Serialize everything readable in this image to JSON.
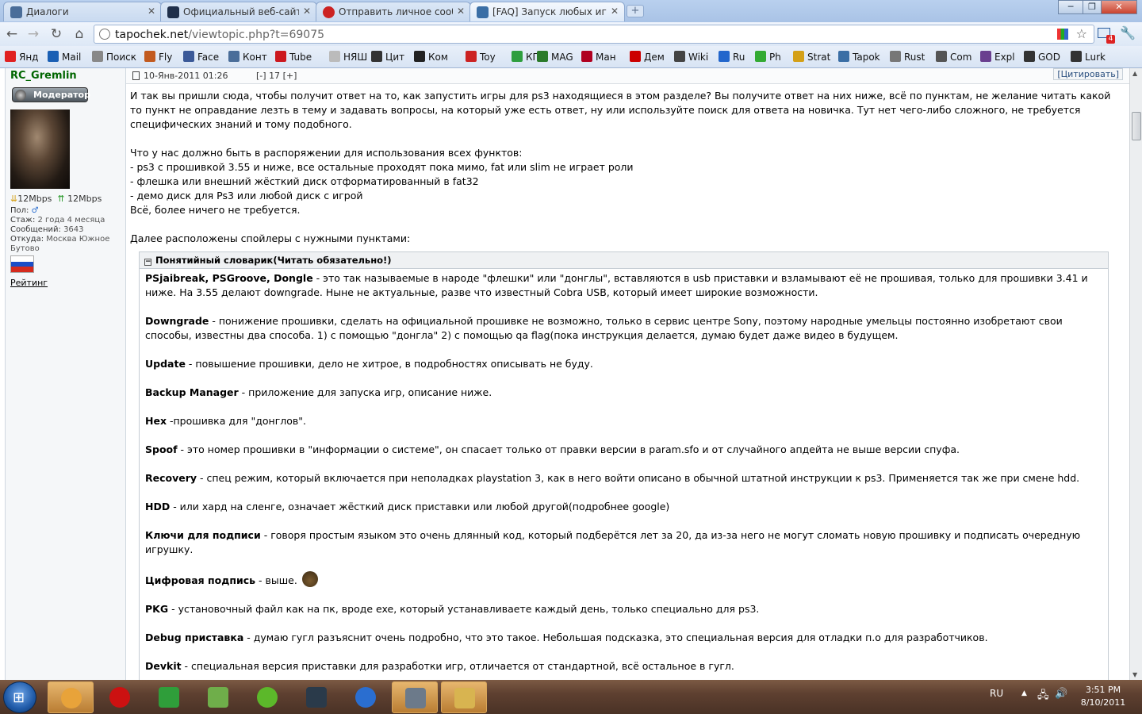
{
  "browser": {
    "tabs": [
      {
        "label": "Диалоги",
        "icon": "vk-icon",
        "color": "#4a6d99"
      },
      {
        "label": "Официальный веб-сайт Pl",
        "icon": "playstation-icon",
        "color": "#1f2f4a"
      },
      {
        "label": "Отправить личное сообщ",
        "icon": "tapochek-icon",
        "color": "#cc2222"
      },
      {
        "label": "[FAQ] Запуск любых игр и",
        "icon": "settings-icon",
        "color": "#3a6ea5"
      }
    ],
    "close_glyph": "✕",
    "new_tab_glyph": "+",
    "window": {
      "minimize": "─",
      "maximize": "❐",
      "close": "✕"
    },
    "url_host": "tapochek.net",
    "url_path": "/viewtopic.php?t=69075",
    "mail_badge": "4",
    "bookmarks": [
      {
        "label": "Янд",
        "color": "#e02020"
      },
      {
        "label": "Mail",
        "color": "#1a5fb4"
      },
      {
        "label": "Поиск",
        "color": "#888888"
      },
      {
        "label": "Fly",
        "color": "#c25a1f"
      },
      {
        "label": "Face",
        "color": "#3b5998"
      },
      {
        "label": "Конт",
        "color": "#4a6d99"
      },
      {
        "label": "Tube",
        "color": "#cc181e"
      },
      {
        "label": "НЯШ",
        "color": "#bbbbbb"
      },
      {
        "label": "Цит",
        "color": "#333333"
      },
      {
        "label": "Ком",
        "color": "#222222"
      },
      {
        "label": "Toy",
        "color": "#cc2222"
      },
      {
        "label": "КГ",
        "color": "#2e9e3e"
      },
      {
        "label": "MAG",
        "color": "#2a7a2a"
      },
      {
        "label": "Ман",
        "color": "#b00020"
      },
      {
        "label": "Дем",
        "color": "#cc0000"
      },
      {
        "label": "Wiki",
        "color": "#444444"
      },
      {
        "label": "Ru",
        "color": "#2266cc"
      },
      {
        "label": "Ph",
        "color": "#33aa33"
      },
      {
        "label": "Strat",
        "color": "#d4a017"
      },
      {
        "label": "Tapok",
        "color": "#3a6ea5"
      },
      {
        "label": "Rust",
        "color": "#777777"
      },
      {
        "label": "Com",
        "color": "#555555"
      },
      {
        "label": "Expl",
        "color": "#6a3f8f"
      },
      {
        "label": "GOD",
        "color": "#333333"
      },
      {
        "label": "Lurk",
        "color": "#333333"
      }
    ]
  },
  "user": {
    "name": "RC_Gremlin",
    "badge": "Модератор",
    "speed_down": "12Mbps",
    "speed_up": "12Mbps",
    "gender_label": "Пол:",
    "gender_value": "♂",
    "stazh_label": "Стаж:",
    "stazh_value": "2 года 4 месяца",
    "messages_label": "Сообщений:",
    "messages_value": "3643",
    "from_label": "Откуда:",
    "from_value": "Москва Южное Бутово",
    "rating": "Рейтинг"
  },
  "post": {
    "date": "10-Янв-2011 01:26",
    "size_minus": "[-]",
    "size_value": "17",
    "size_plus": "[+]",
    "cite": "[Цитировать]",
    "intro": "И так вы пришли сюда, чтобы получит ответ на то, как запустить игры для ps3 находящиеся в этом разделе? Вы получите ответ на них ниже, всё по пунктам, не желание читать какой то пункт не оправдание лезть в тему и задавать вопросы, на который уже есть ответ, ну или используйте поиск для ответа на новичка. Тут нет чего-либо сложного, не требуется специфических знаний и тому подобного.",
    "need_title": "Что у нас должно быть в распоряжении для использования всех функтов:",
    "need_1": "- ps3 с прошивкой 3.55 и ниже, все остальные проходят пока мимо, fat или slim не играет роли",
    "need_2": "- флешка или внешний жёсткий диск отформатированный в fat32",
    "need_3": "- демо диск для Ps3 или любой диск с игрой",
    "need_end": "Всё, более ничего не требуется.",
    "spoilers_note": "Далее расположены спойлеры с нужными пунктами:",
    "spoiler_title": "Понятийный словарик(Читать обязательно!)",
    "terms": [
      {
        "term": "PSjaibreak, PSGroove, Dongle",
        "desc": " - это так называемые в народе \"флешки\" или \"донглы\", вставляются в usb приставки и взламывают её не прошивая, только для прошивки 3.41 и ниже. На 3.55 делают downgrade. Ныне не актуальные, разве что известный Cobra USB, который имеет широкие возможности."
      },
      {
        "term": "Downgrade",
        "desc": " - понижение прошивки, сделать на официальной прошивке не возможно, только в сервис центре Sony, поэтому народные умельцы постоянно изобретают свои способы, известны два способа. 1) с помощью \"донгла\" 2) с помощью qa flag(пока инструкция делается, думаю будет даже видео в будущем."
      },
      {
        "term": "Update",
        "desc": " - повышение прошивки, дело не хитрое, в подробностях описывать не буду."
      },
      {
        "term": "Backup Manager",
        "desc": " - приложение для запуска игр, описание ниже."
      },
      {
        "term": "Hex",
        "desc": " -прошивка для \"донглов\"."
      },
      {
        "term": "Spoof",
        "desc": " - это номер прошивки в \"информации о системе\", он спасает только от правки версии в param.sfo и от случайного апдейта не выше версии спуфа."
      },
      {
        "term": "Recovery",
        "desc": " - спец режим, который включается при неполадках playstation 3, как в него войти описано в обычной штатной инструкции к ps3. Применяется так же при смене hdd."
      },
      {
        "term": "HDD",
        "desc": " - или хард на сленге, означает жёсткий диск приставки или любой другой(подробнее google)"
      },
      {
        "term": "Ключи для подписи",
        "desc": " - говоря простым языком это очень длянный код, который подберётся лет за 20, да из-за него не могут сломать новую прошивку и подписать очередную игрушку."
      },
      {
        "term": "Цифровая подпись",
        "desc": " - выше."
      },
      {
        "term": "PKG",
        "desc": " - установочный файл как на пк, вроде exe, который устанавливаете каждый день, только специально для ps3."
      },
      {
        "term": "Debug приставка",
        "desc": " - думаю гугл разъяснит очень подробно, что это такое. Небольшая подсказка, это специальная версия для отладки п.о для разработчиков."
      },
      {
        "term": "Devkit",
        "desc": " - специальная версия приставки для разработки игр, отличается от стандартной, всё остальное в гугл."
      }
    ]
  },
  "taskbar": {
    "apps": [
      {
        "name": "chrome",
        "color": "#e8a33a"
      },
      {
        "name": "opera",
        "color": "#cc1111"
      },
      {
        "name": "utorrent",
        "color": "#2f9e3a"
      },
      {
        "name": "totalcmd",
        "color": "#6fae4a"
      },
      {
        "name": "icq",
        "color": "#5cb82a"
      },
      {
        "name": "steam",
        "color": "#2a3a4a"
      },
      {
        "name": "itunes",
        "color": "#2a6ed0"
      },
      {
        "name": "tool",
        "color": "#6c7a8a"
      },
      {
        "name": "explorer",
        "color": "#d8b450"
      }
    ],
    "lang": "RU",
    "time": "3:51 PM",
    "date": "8/10/2011"
  }
}
